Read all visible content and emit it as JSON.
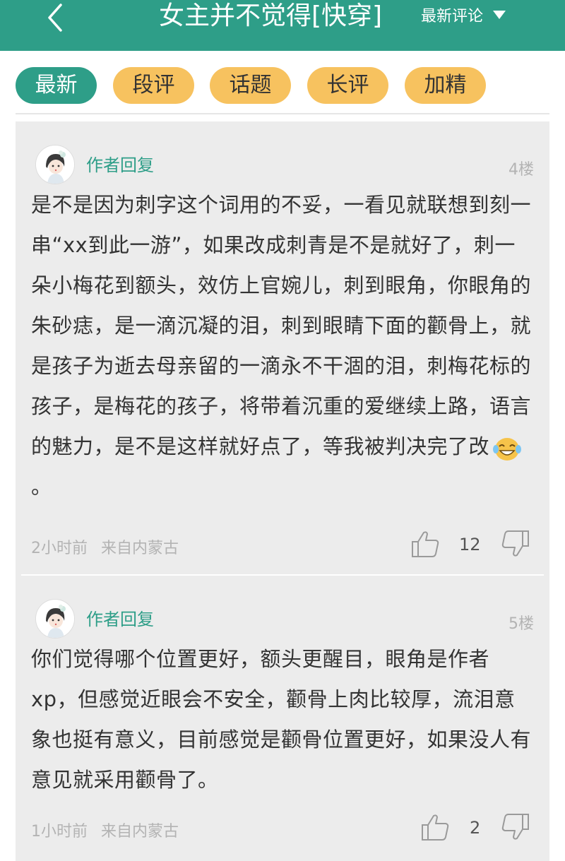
{
  "header": {
    "title": "女主并不觉得[快穿]",
    "sort_label": "最新评论"
  },
  "tabs": [
    {
      "label": "最新"
    },
    {
      "label": "段评"
    },
    {
      "label": "话题"
    },
    {
      "label": "长评"
    },
    {
      "label": "加精"
    }
  ],
  "comments": [
    {
      "author": "作者回复",
      "floor": "4楼",
      "text_main": "是不是因为刺字这个词用的不妥，一看见就联想到刻一串“xx到此一游”，如果改成刺青是不是就好了，刺一朵小梅花到额头，效仿上官婉儿，刺到眼角，你眼角的朱砂痣，是一滴沉凝的泪，刺到眼睛下面的颧骨上，就是孩子为逝去母亲留的一滴永不干涸的泪，刺梅花标的孩子，是梅花的孩子，将带着沉重的爱继续上路，语言的魅力，是不是这样就好点了，等我被判决完了改",
      "text_tail": "。",
      "time": "2小时前",
      "location": "来自内蒙古",
      "likes": "12"
    },
    {
      "author": "作者回复",
      "floor": "5楼",
      "text_main": "你们觉得哪个位置更好，额头更醒目，眼角是作者xp，但感觉近眼会不安全，颧骨上肉比较厚，流泪意象也挺有意义，目前感觉是颧骨位置更好，如果没人有意见就采用颧骨了。",
      "time": "1小时前",
      "location": "来自内蒙古",
      "likes": "2"
    }
  ],
  "colors": {
    "accent": "#2e9e88",
    "tab_inactive": "#f7c25f",
    "panel_bg": "#ececec"
  }
}
